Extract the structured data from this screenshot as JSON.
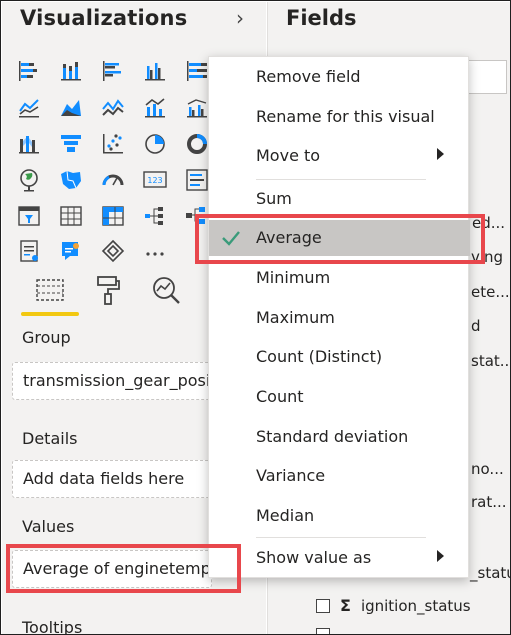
{
  "visualizations": {
    "title": "Visualizations",
    "expand_icon": "chevron-right-icon",
    "icons": [
      "stacked-bar-chart-icon",
      "stacked-column-chart-icon",
      "clustered-bar-chart-icon",
      "clustered-column-chart-icon",
      "100-stacked-bar-chart-icon",
      "line-chart-icon",
      "area-chart-icon",
      "stacked-area-chart-icon",
      "line-and-column-chart-icon",
      "line-and-clustered-column-chart-icon",
      "ribbon-chart-icon",
      "funnel-icon",
      "scatter-chart-icon",
      "pie-chart-icon",
      "donut-chart-icon",
      "map-icon",
      "filled-map-icon",
      "gauge-icon",
      "card-icon",
      "multi-row-card-icon",
      "slicer-icon",
      "table-icon",
      "matrix-icon",
      "decomposition-tree-icon",
      "key-influencers-icon",
      "smart-narrative-icon",
      "qa-visual-icon",
      "power-apps-icon",
      "more-visuals-icon"
    ],
    "tools": [
      "fields-icon",
      "format-paint-roller-icon",
      "analytics-icon"
    ]
  },
  "wells": {
    "group_label": "Group",
    "group_value": "transmission_gear_posit",
    "details_label": "Details",
    "details_placeholder": "Add data fields here",
    "values_label": "Values",
    "values_value": "Average of enginetempe",
    "tooltips_label": "Tooltips"
  },
  "fields": {
    "title": "Fields",
    "partial_labels": [
      "ed...",
      "ving",
      "ete...",
      "d",
      "stat...",
      "no...",
      "rat...",
      "_status"
    ],
    "ignition_label": "ignition_status",
    "sigma": "Σ"
  },
  "context_menu": {
    "items": [
      {
        "label": "Remove field"
      },
      {
        "label": "Rename for this visual"
      },
      {
        "label": "Move to"
      },
      {
        "label": "Sum"
      },
      {
        "label": "Average"
      },
      {
        "label": "Minimum"
      },
      {
        "label": "Maximum"
      },
      {
        "label": "Count (Distinct)"
      },
      {
        "label": "Count"
      },
      {
        "label": "Standard deviation"
      },
      {
        "label": "Variance"
      },
      {
        "label": "Median"
      },
      {
        "label": "Show value as"
      }
    ],
    "selected_color": "#c8c6c4",
    "check_color": "#3a9b7a"
  },
  "highlight_color": "#e8474c"
}
